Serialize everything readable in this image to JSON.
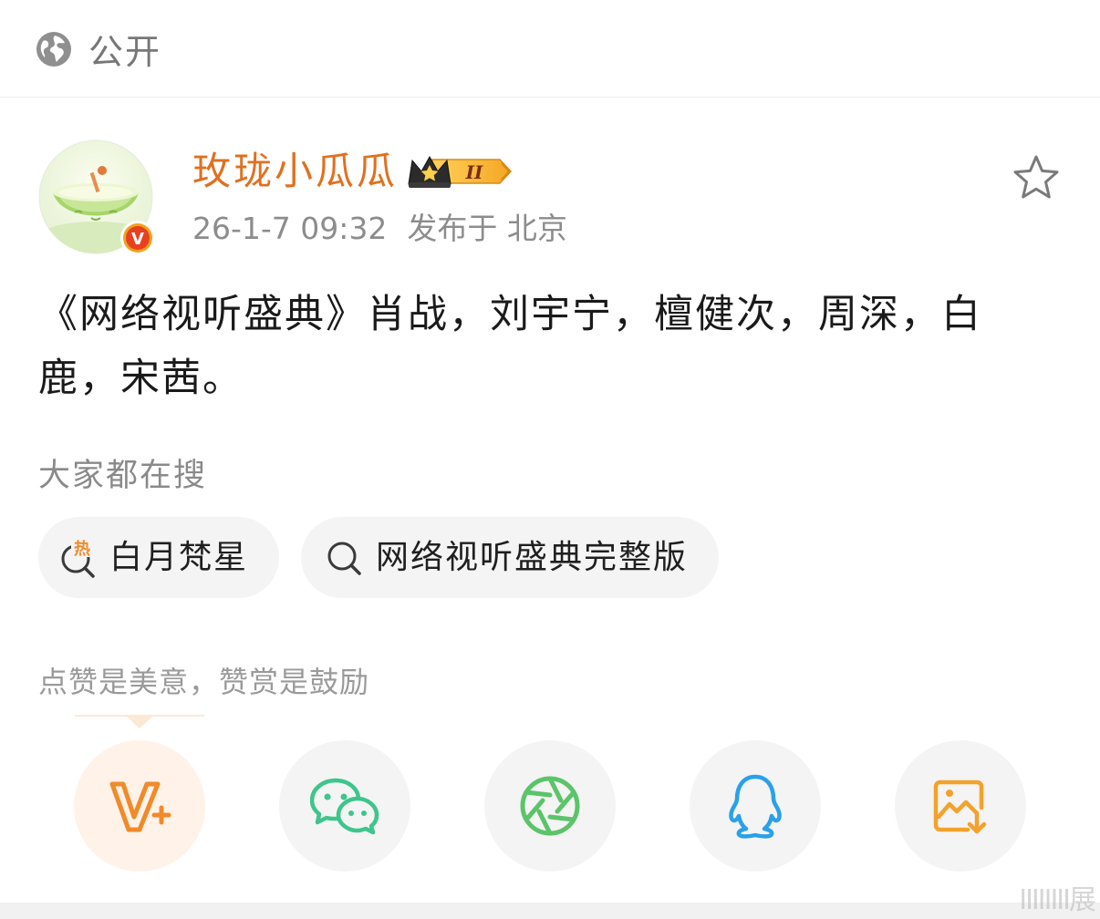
{
  "header": {
    "visibility_icon": "globe-icon",
    "visibility_label": "公开"
  },
  "post": {
    "author": {
      "name": "玫珑小瓜瓜",
      "avatar": "melon-avatar",
      "verified_badge": "V",
      "vip_badge_icon": "crown-icon",
      "vip_level": "II"
    },
    "favorite_icon": "star-outline-icon",
    "timestamp": "26-1-7 09:32",
    "location": "发布于 北京",
    "text": "《网络视听盛典》肖战，刘宇宁，檀健次，周深，白鹿，宋茜。"
  },
  "trending": {
    "title": "大家都在搜",
    "items": [
      {
        "label": "白月梵星",
        "icon": "hot-search-icon",
        "hot_mark": "热"
      },
      {
        "label": "网络视听盛典完整版",
        "icon": "search-icon"
      }
    ]
  },
  "reward": {
    "hint": "点赞是美意，赞赏是鼓励"
  },
  "share": {
    "buttons": [
      {
        "name": "reward",
        "icon": "v-plus-icon"
      },
      {
        "name": "wechat",
        "icon": "wechat-icon"
      },
      {
        "name": "moments",
        "icon": "moments-icon"
      },
      {
        "name": "qq",
        "icon": "qq-icon"
      },
      {
        "name": "save-image",
        "icon": "save-image-icon"
      }
    ]
  },
  "colors": {
    "username": "#e0701f",
    "accent_orange": "#f08a2a",
    "wechat_green": "#3ec58c",
    "moments_green": "#5bc46a",
    "qq_blue": "#2aa0ea",
    "save_orange": "#f4a12c"
  },
  "watermark": "IIIIIIII展"
}
